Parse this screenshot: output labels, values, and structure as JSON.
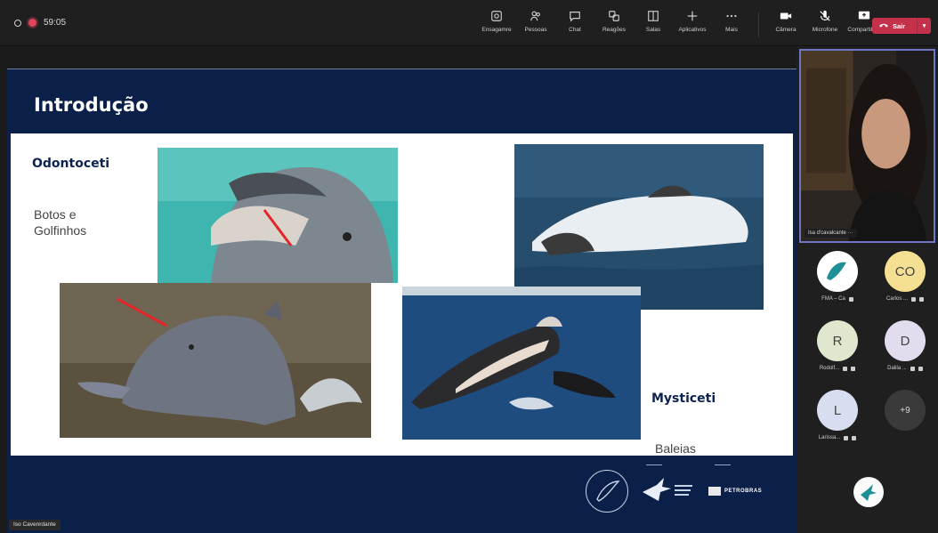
{
  "topbar": {
    "timer": "59:05",
    "tools": [
      {
        "label": "Ensagamre",
        "icon": "camera-icon"
      },
      {
        "label": "Pessoas",
        "icon": "people-icon"
      },
      {
        "label": "Chat",
        "icon": "chat-icon"
      },
      {
        "label": "Reagões",
        "icon": "reactions-icon"
      },
      {
        "label": "Salas",
        "icon": "rooms-icon"
      },
      {
        "label": "Aplicativos",
        "icon": "plus-icon"
      },
      {
        "label": "Mais",
        "icon": "more-icon"
      }
    ],
    "devices": [
      {
        "label": "Câmera",
        "icon": "video-icon"
      },
      {
        "label": "Microfone",
        "icon": "mic-icon"
      },
      {
        "label": "Compartilhar",
        "icon": "share-icon"
      }
    ],
    "leave_label": "Sair"
  },
  "slide": {
    "title": "Introdução",
    "odontoceti": "Odontoceti",
    "botos": "Botos e Golfinhos",
    "mysticeti": "Mysticeti",
    "baleias": "Baleias",
    "footer_brand": "PETROBRAS"
  },
  "share_caption": "Iso Cavenrdante",
  "presenter": {
    "label": "Isa d'cavalcante ···"
  },
  "participants": [
    {
      "initials": "",
      "name": "FMA – Ca",
      "color": "#ffffff"
    },
    {
      "initials": "CO",
      "name": "Carlos ...",
      "color": "#f4df92"
    },
    {
      "initials": "R",
      "name": "Rodolf...",
      "color": "#dfe8cf"
    },
    {
      "initials": "D",
      "name": "Dalila ...",
      "color": "#e3dcee"
    },
    {
      "initials": "L",
      "name": "Larissa...",
      "color": "#d7deef"
    },
    {
      "initials": "+9",
      "name": "",
      "color": "#3a3a3a"
    }
  ]
}
